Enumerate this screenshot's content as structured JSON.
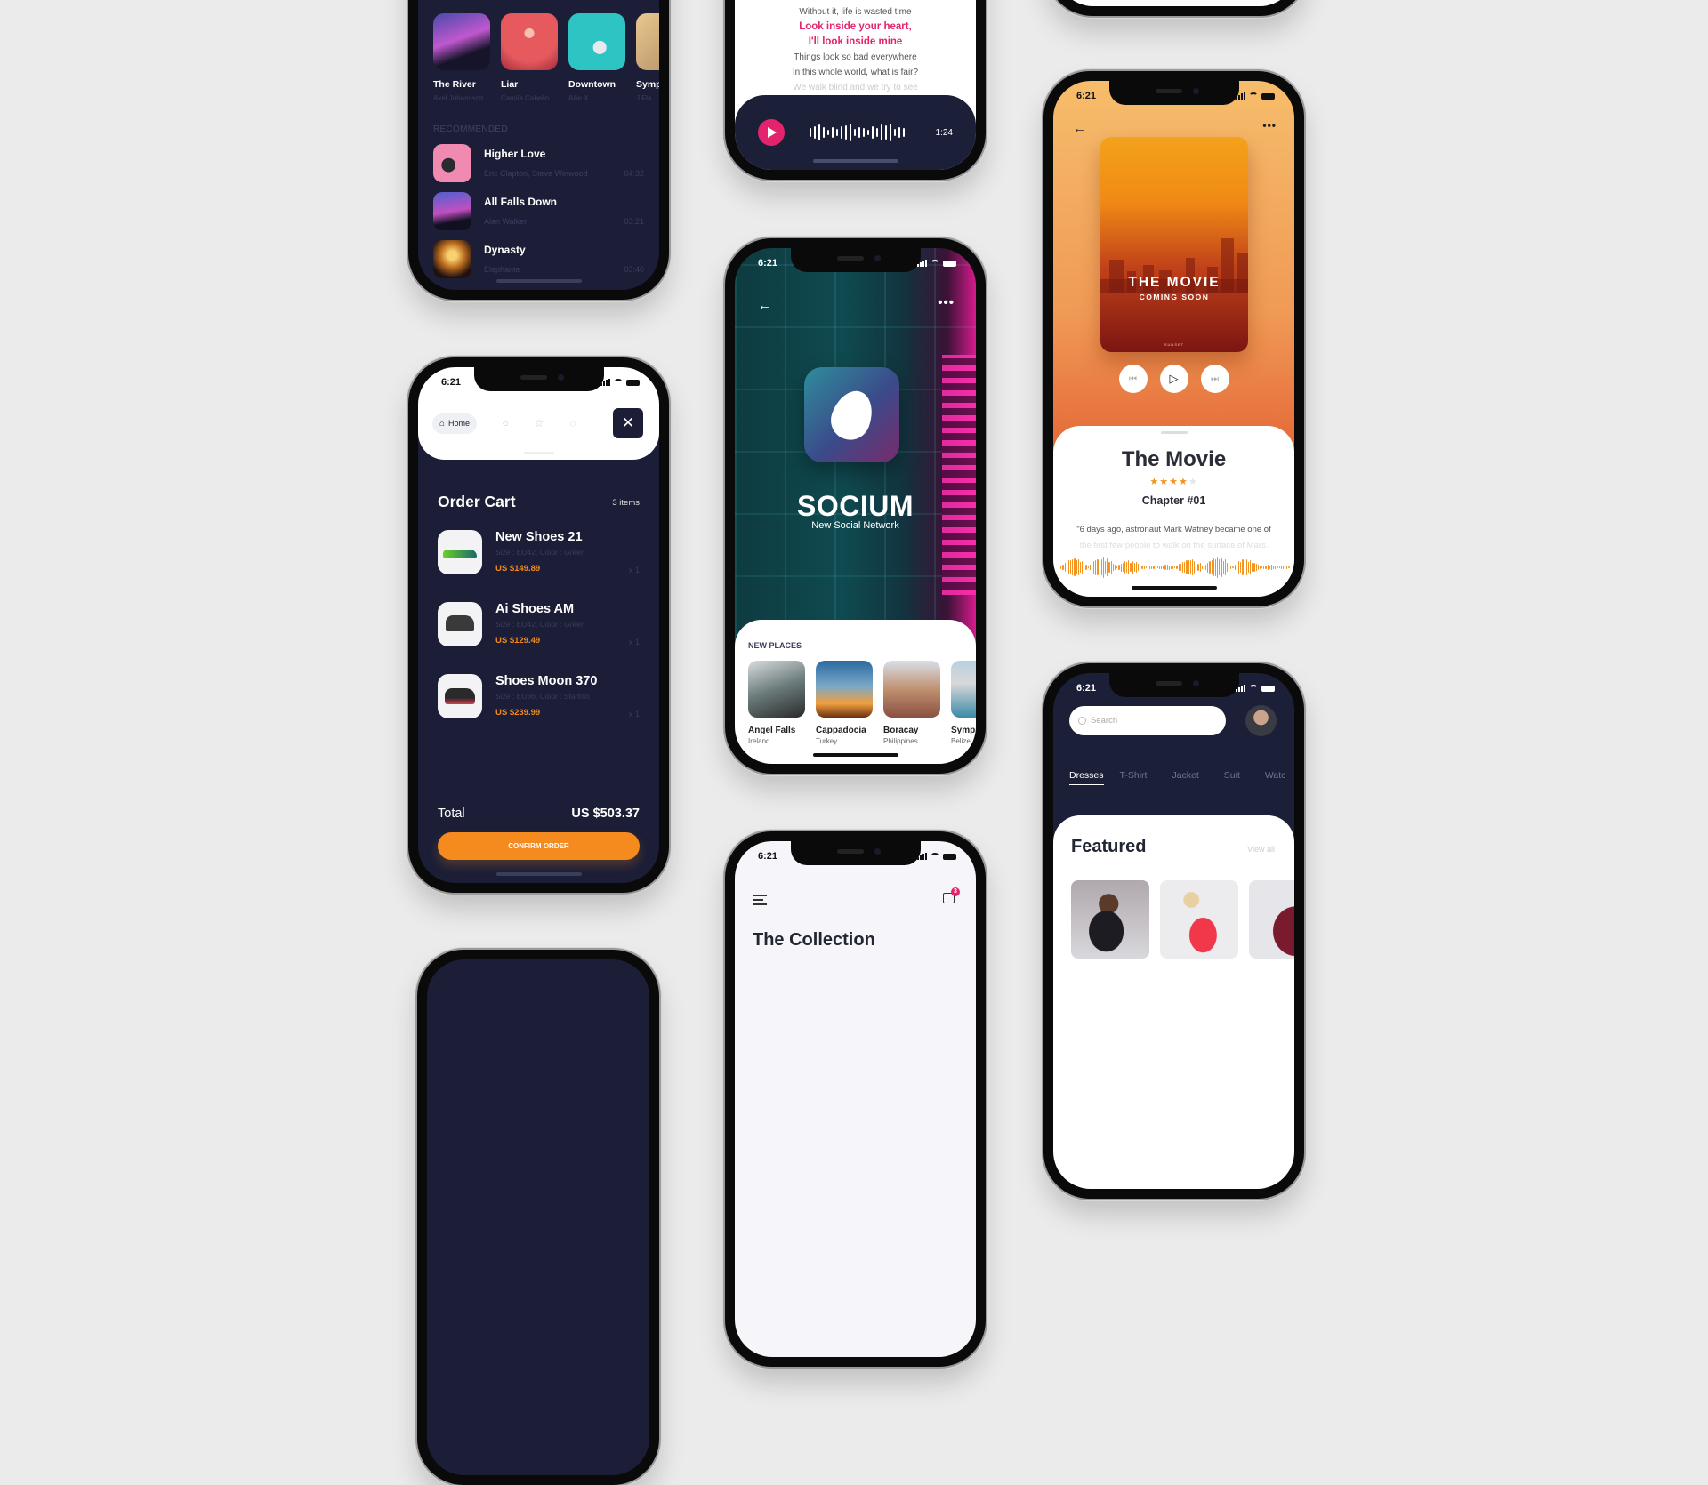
{
  "music_app": {
    "albums": [
      {
        "title": "The River",
        "artist": "Axel Johansson"
      },
      {
        "title": "Liar",
        "artist": "Camila Cabello"
      },
      {
        "title": "Downtown",
        "artist": "Allie X"
      },
      {
        "title": "Symp",
        "artist": "J.Fla"
      }
    ],
    "recommended_label": "RECOMMENDED",
    "recommended": [
      {
        "title": "Higher Love",
        "artist": "Eric Clapton, Steve Winwood",
        "duration": "04:32"
      },
      {
        "title": "All Falls Down",
        "artist": "Alan Walker",
        "duration": "03:21"
      },
      {
        "title": "Dynasty",
        "artist": "Elephante",
        "duration": "03:40"
      }
    ]
  },
  "lyrics_app": {
    "lines": [
      {
        "text": "Without it, life is wasted time",
        "style": "normal"
      },
      {
        "text": "Look inside your heart,",
        "style": "highlight"
      },
      {
        "text": "I'll look inside mine",
        "style": "highlight"
      },
      {
        "text": "Things look so bad everywhere",
        "style": "normal"
      },
      {
        "text": "In this whole world, what is fair?",
        "style": "normal"
      },
      {
        "text": "We walk blind and we try to see",
        "style": "fade"
      }
    ],
    "player": {
      "time": "1:24",
      "play_icon": "play-icon"
    }
  },
  "cart_app": {
    "status_time": "6:21",
    "nav": {
      "home_label": "Home",
      "icons": [
        "home-icon",
        "search-icon",
        "star-icon",
        "bell-icon",
        "close-icon"
      ],
      "close_glyph": "✕"
    },
    "title": "Order Cart",
    "item_count": "3 items",
    "items": [
      {
        "name": "New Shoes 21",
        "details": "Size : EU42, Color : Green",
        "price": "US $149.89",
        "qty": "x 1"
      },
      {
        "name": "Ai Shoes AM",
        "details": "Size : EU42, Color : Green",
        "price": "US $129.49",
        "qty": "x 1"
      },
      {
        "name": "Shoes Moon 370",
        "details": "Size : EU36, Color : Starfish",
        "price": "US $239.99",
        "qty": "x 1"
      }
    ],
    "total_label": "Total",
    "total_value": "US $503.37",
    "confirm_label": "CONFIRM ORDER"
  },
  "social_app": {
    "status_time": "6:21",
    "back_glyph": "←",
    "more_glyph": "•••",
    "brand": "SOCIUM",
    "tagline": "New Social Network",
    "places_label": "NEW PLACES",
    "places": [
      {
        "name": "Angel Falls",
        "country": "Ireland"
      },
      {
        "name": "Cappadocia",
        "country": "Turkey"
      },
      {
        "name": "Boracay",
        "country": "Philippines"
      },
      {
        "name": "Symp",
        "country": "Belize"
      }
    ]
  },
  "collection_app": {
    "status_time": "6:21",
    "cart_badge": "3",
    "title": "The Collection"
  },
  "movie_app": {
    "status_time": "6:21",
    "back_glyph": "←",
    "more_glyph": "•••",
    "poster_title": "THE MOVIE",
    "poster_subtitle": "COMING SOON",
    "poster_brand": "SUNSET",
    "controls": {
      "prev": "⏮",
      "play": "▷",
      "next": "⏭"
    },
    "title": "The Movie",
    "rating": 4,
    "rating_max": 5,
    "chapter": "Chapter #01",
    "quote_line1": "\"6 days ago, astronaut Mark Watney became one of",
    "quote_line2": "the first few people to walk on the surface of Mars.",
    "accent": "#f39422"
  },
  "fashion_app": {
    "status_time": "6:21",
    "search_placeholder": "Search",
    "categories": [
      "Dresses",
      "T-Shirt",
      "Jacket",
      "Suit",
      "Watc"
    ],
    "active_category": 0,
    "featured_title": "Featured",
    "view_all": "View all"
  },
  "colors": {
    "background": "#ebebeb",
    "navy": "#1b1e36",
    "pink_accent": "#e3246d",
    "orange_accent": "#f58a1f"
  }
}
